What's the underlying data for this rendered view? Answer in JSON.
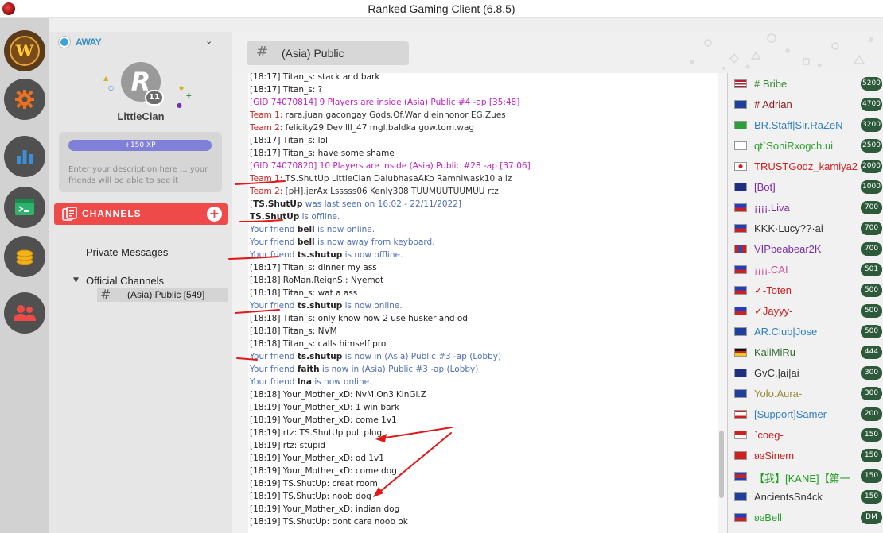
{
  "window": {
    "title": "Ranked Gaming Client (6.8.5)"
  },
  "rail": {
    "items": [
      {
        "name": "warcraft-logo",
        "glyph": "W"
      },
      {
        "name": "settings",
        "glyph": "gear"
      },
      {
        "name": "stats",
        "glyph": "bars"
      },
      {
        "name": "console",
        "glyph": "terminal"
      },
      {
        "name": "coins",
        "glyph": "coins"
      },
      {
        "name": "friends",
        "glyph": "users"
      }
    ]
  },
  "profile": {
    "status": "AWAY",
    "username": "LittleCian",
    "level": "11",
    "avatar_letter": "R",
    "xp": "+150 XP",
    "description_placeholder": "Enter your description here ... your friends will be able to see it"
  },
  "channels": {
    "header": "CHANNELS",
    "private_messages": "Private Messages",
    "official_label": "Official Channels",
    "official_channel": "(Asia) Public [549]"
  },
  "main": {
    "tab_label": "(Asia) Public"
  },
  "chat": {
    "messages": [
      {
        "parts": [
          {
            "t": "[18:17] Titan_s: stack and bark",
            "c": "c-norm"
          }
        ]
      },
      {
        "parts": [
          {
            "t": "[18:17] Titan_s: ?",
            "c": "c-norm"
          }
        ]
      },
      {
        "parts": [
          {
            "t": "[GID 74070814]",
            "c": "c-gid"
          },
          {
            "t": " 9 Players are inside ",
            "c": "c-gid"
          },
          {
            "t": "(Asia) Public #4 -ap [35:48]",
            "c": "c-gid"
          }
        ]
      },
      {
        "parts": [
          {
            "t": "Team 1:",
            "c": "c-team"
          },
          {
            "t": "  rara.juan   gacongay   Gods.Of.War   dieinhonor   EG.Zues",
            "c": "c-dark"
          }
        ]
      },
      {
        "parts": [
          {
            "t": "Team 2:",
            "c": "c-team"
          },
          {
            "t": "  felicity29   Devilll_47   mgl.baldka   gow.tom.wag",
            "c": "c-dark"
          }
        ]
      },
      {
        "parts": [
          {
            "t": "[18:17] Titan_s: lol",
            "c": "c-norm"
          }
        ]
      },
      {
        "parts": [
          {
            "t": "[18:17] Titan_s: have some shame",
            "c": "c-norm"
          }
        ]
      },
      {
        "parts": [
          {
            "t": "[GID 74070820]",
            "c": "c-gid"
          },
          {
            "t": " 10 Players are inside ",
            "c": "c-gid"
          },
          {
            "t": "(Asia) Public #28 -ap [37:06]",
            "c": "c-gid"
          }
        ]
      },
      {
        "parts": [
          {
            "t": "Team 1:",
            "c": "c-team"
          },
          {
            "t": "  TS.ShutUp   LittleCian   DalubhasaAKo   Ramniwask10   allz",
            "c": "c-dark"
          }
        ]
      },
      {
        "parts": [
          {
            "t": "Team 2:",
            "c": "c-team"
          },
          {
            "t": "  [pH].jerAx   Lsssss06   Kenly308   TUUMUUTUUMUU   rtz",
            "c": "c-dark"
          }
        ]
      },
      {
        "parts": [
          {
            "t": "[",
            "c": "c-sys"
          },
          {
            "t": "TS.ShutUp",
            "c": "c-bold"
          },
          {
            "t": " was last seen on 16:02 - 22/11/2022]",
            "c": "c-sys"
          }
        ]
      },
      {
        "parts": [
          {
            "t": "TS.ShutUp",
            "c": "c-bold"
          },
          {
            "t": " is offline.",
            "c": "c-sys"
          }
        ]
      },
      {
        "parts": [
          {
            "t": "Your friend ",
            "c": "c-sys"
          },
          {
            "t": "bell",
            "c": "c-bold"
          },
          {
            "t": " is now online.",
            "c": "c-sys"
          }
        ]
      },
      {
        "parts": [
          {
            "t": "Your friend ",
            "c": "c-sys"
          },
          {
            "t": "bell",
            "c": "c-bold"
          },
          {
            "t": " is now away from keyboard.",
            "c": "c-sys"
          }
        ]
      },
      {
        "parts": [
          {
            "t": "Your friend ",
            "c": "c-sys"
          },
          {
            "t": "ts.shutup",
            "c": "c-bold"
          },
          {
            "t": " is now offline.",
            "c": "c-sys"
          }
        ]
      },
      {
        "parts": [
          {
            "t": "[18:17] Titan_s: dinner my ass",
            "c": "c-norm"
          }
        ]
      },
      {
        "parts": [
          {
            "t": "[18:18] RoMan.ReignS.: Nyemot",
            "c": "c-norm"
          }
        ]
      },
      {
        "parts": [
          {
            "t": "[18:18] Titan_s: wat a ass",
            "c": "c-norm"
          }
        ]
      },
      {
        "parts": [
          {
            "t": "Your friend ",
            "c": "c-sys"
          },
          {
            "t": "ts.shutup",
            "c": "c-bold"
          },
          {
            "t": " is now online.",
            "c": "c-sys"
          }
        ]
      },
      {
        "parts": [
          {
            "t": "[18:18] Titan_s: only know how 2 use husker and od",
            "c": "c-norm"
          }
        ]
      },
      {
        "parts": [
          {
            "t": "[18:18] Titan_s: NVM",
            "c": "c-norm"
          }
        ]
      },
      {
        "parts": [
          {
            "t": "[18:18] Titan_s: calls himself pro",
            "c": "c-norm"
          }
        ]
      },
      {
        "parts": [
          {
            "t": "Your friend ",
            "c": "c-sys"
          },
          {
            "t": "ts.shutup",
            "c": "c-bold"
          },
          {
            "t": " is now in (Asia) Public #3 -ap (Lobby)",
            "c": "c-sys"
          }
        ]
      },
      {
        "parts": [
          {
            "t": "Your friend ",
            "c": "c-sys"
          },
          {
            "t": "faith",
            "c": "c-bold"
          },
          {
            "t": " is now in (Asia) Public #3 -ap (Lobby)",
            "c": "c-sys"
          }
        ]
      },
      {
        "parts": [
          {
            "t": "Your friend ",
            "c": "c-sys"
          },
          {
            "t": "lna",
            "c": "c-bold"
          },
          {
            "t": " is now online.",
            "c": "c-sys"
          }
        ]
      },
      {
        "parts": [
          {
            "t": "[18:18] Your_Mother_xD: NvM.On3lKinGl.Z",
            "c": "c-norm"
          }
        ]
      },
      {
        "parts": [
          {
            "t": "[18:19] Your_Mother_xD: 1 win bark",
            "c": "c-norm"
          }
        ]
      },
      {
        "parts": [
          {
            "t": "[18:19] Your_Mother_xD: come 1v1",
            "c": "c-norm"
          }
        ]
      },
      {
        "parts": [
          {
            "t": "[18:19] rtz: TS.ShutUp pull plug",
            "c": "c-norm"
          }
        ]
      },
      {
        "parts": [
          {
            "t": "[18:19] rtz: stupid",
            "c": "c-norm"
          }
        ]
      },
      {
        "parts": [
          {
            "t": "[18:19] Your_Mother_xD: od 1v1",
            "c": "c-norm"
          }
        ]
      },
      {
        "parts": [
          {
            "t": "[18:19] Your_Mother_xD: come dog",
            "c": "c-norm"
          }
        ]
      },
      {
        "parts": [
          {
            "t": "[18:19] TS.ShutUp: creat room",
            "c": "c-norm"
          }
        ]
      },
      {
        "parts": [
          {
            "t": "[18:19] TS.ShutUp: noob dog",
            "c": "c-norm"
          }
        ]
      },
      {
        "parts": [
          {
            "t": "[18:19] Your_Mother_xD: indian dog",
            "c": "c-norm"
          }
        ]
      },
      {
        "parts": [
          {
            "t": "[18:19] TS.ShutUp: dont care noob ok",
            "c": "c-norm"
          }
        ]
      }
    ]
  },
  "players": [
    {
      "name": "# Bribe",
      "color": "#2e8b2e",
      "badge": "5200",
      "flag": "us"
    },
    {
      "name": "# Adrian",
      "color": "#8b1a1a",
      "badge": "4700",
      "flag": "eu"
    },
    {
      "name": "BR.Staff|Sir.RaZeN",
      "color": "#2f7fc0",
      "badge": "3200",
      "flag": "br"
    },
    {
      "name": "qt`SoniRxogch.ui",
      "color": "#2f9f2f",
      "badge": "2500",
      "flag": "kr"
    },
    {
      "name": "TRUSTGodz_kamiya2",
      "color": "#cc1f1f",
      "badge": "2000",
      "flag": "jp"
    },
    {
      "name": "[Bot]",
      "color": "#7a2fa8",
      "badge": "1000",
      "flag": "uk"
    },
    {
      "name": "¡¡¡¡.Liva",
      "color": "#7a2fa8",
      "badge": "700",
      "flag": "ph"
    },
    {
      "name": "KKK·Lucy??·ai",
      "color": "#333333",
      "badge": "700",
      "flag": "ph"
    },
    {
      "name": "VIPbeabear2K",
      "color": "#7a2fa8",
      "badge": "700",
      "flag": "mn"
    },
    {
      "name": "¡¡¡¡.CAI",
      "color": "#d050a0",
      "badge": "501",
      "flag": "ph"
    },
    {
      "name": "✓-Toten",
      "color": "#cc1f1f",
      "badge": "500",
      "flag": "ph"
    },
    {
      "name": "✓Jayyy-",
      "color": "#cc1f1f",
      "badge": "500",
      "flag": "ph"
    },
    {
      "name": "AR.Club|Jose",
      "color": "#2f7fc0",
      "badge": "500",
      "flag": "eu"
    },
    {
      "name": "KaliMiRu",
      "color": "#2e6b2e",
      "badge": "444",
      "flag": "de"
    },
    {
      "name": "GvC.|ai|ai",
      "color": "#333333",
      "badge": "300",
      "flag": "nz"
    },
    {
      "name": "Yolo.Aura-",
      "color": "#9b8b3a",
      "badge": "300",
      "flag": "eu"
    },
    {
      "name": "[Support]Samer",
      "color": "#2f7fc0",
      "badge": "200",
      "flag": "lb"
    },
    {
      "name": "`coeg-",
      "color": "#cc1f1f",
      "badge": "150",
      "flag": "id"
    },
    {
      "name": "ʚɞSinem",
      "color": "#cc1f1f",
      "badge": "150",
      "flag": "tr"
    },
    {
      "name": "【我】[KANE]【第一",
      "color": "#1f9f1f",
      "badge": "150",
      "flag": "kh"
    },
    {
      "name": "AncientsSn4ck",
      "color": "#333333",
      "badge": "150",
      "flag": "eu"
    },
    {
      "name": "ʚɞBell",
      "color": "#2f9f2f",
      "badge": "DM",
      "flag": "ph"
    }
  ],
  "colors": {
    "accent": "#ef4a4a",
    "rail_bg": "#d2d2d2",
    "panel_bg": "#e6e6e6",
    "badge_bg": "#2d5a3a",
    "system_text": "#4f6fb5",
    "game_info_text": "#c020c0",
    "team_label_text": "#d02020",
    "annotation_red": "#e01818"
  }
}
